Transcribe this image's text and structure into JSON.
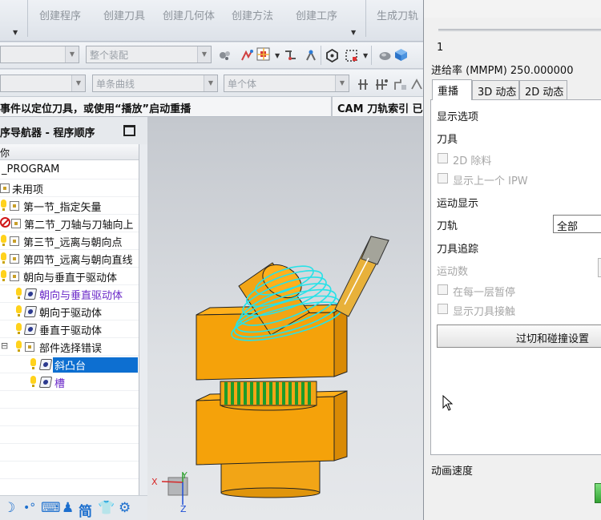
{
  "ribbon": {
    "buttons": [
      "创建程序",
      "创建刀具",
      "创建几何体",
      "创建方法",
      "创建工序",
      "生成刀轨"
    ]
  },
  "toolbar": {
    "assembly_combo": "整个装配",
    "curve_rule_combo": "单条曲线",
    "body_rule_combo": "单个体"
  },
  "statusbar": {
    "message": "事件以定位刀具，或使用“播放”启动重播",
    "toolpath_index": "CAM 刀轨索引 已"
  },
  "navigator": {
    "title": "序导航器 - 程序顺序",
    "column_header": "你",
    "items": [
      {
        "label": "_PROGRAM"
      },
      {
        "label": "未用项"
      },
      {
        "label": "第一节_指定矢量"
      },
      {
        "label": "第二节_刀轴与刀轴向上"
      },
      {
        "label": "第三节_远离与朝向点"
      },
      {
        "label": "第四节_远离与朝向直线"
      },
      {
        "label": "朝向与垂直于驱动体"
      },
      {
        "label": "朝向与垂直驱动体"
      },
      {
        "label": "朝向于驱动体"
      },
      {
        "label": "垂直于驱动体"
      },
      {
        "label": "部件选择错误"
      },
      {
        "label": "斜凸台"
      },
      {
        "label": "槽"
      }
    ]
  },
  "viewport": {
    "triad": {
      "x_label": "X",
      "y_label": "Y",
      "z_label": "Z"
    }
  },
  "panel": {
    "value_one": "1",
    "feed_rate": "进给率 (MMPM) 250.000000",
    "tabs": [
      "重播",
      "3D 动态",
      "2D 动态"
    ],
    "display_options": "显示选项",
    "tool_section": "刀具",
    "cb_2d_remove": "2D 除料",
    "cb_prev_ipw": "显示上一个 IPW",
    "motion_display": "运动显示",
    "toolpath_label": "刀轨",
    "toolpath_value": "全部",
    "tool_trace": "刀具追踪",
    "motion_count": "运动数",
    "cb_pause_layer": "在每一层暂停",
    "cb_show_contact": "显示刀具接触",
    "collision_button": "过切和碰撞设置",
    "animation_speed": "动画速度"
  },
  "colors": {
    "selection": "#0d6fd1",
    "part_orange": "#f5a20a",
    "toolpath_cyan": "#27e2e8",
    "tool_body": "#e8b13a",
    "stripe_green": "#1c9c2a",
    "folder_purple": "#6a28c8"
  }
}
